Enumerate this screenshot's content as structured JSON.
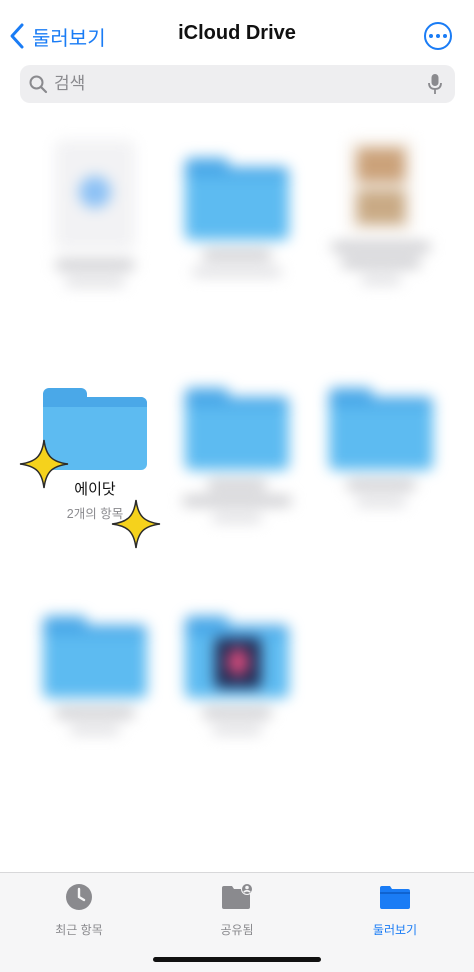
{
  "nav": {
    "back_label": "둘러보기",
    "title": "iCloud Drive",
    "more_icon": "ellipsis-circle-icon"
  },
  "search": {
    "placeholder": "검색",
    "icon": "magnifier-icon",
    "mic_icon": "microphone-icon"
  },
  "items": [
    {
      "kind": "document",
      "name": "",
      "blurred": true
    },
    {
      "kind": "folder",
      "name": "",
      "blurred": true
    },
    {
      "kind": "photo-document",
      "name": "",
      "blurred": true
    },
    {
      "kind": "folder",
      "name": "에이닷",
      "subtitle": "2개의 항목",
      "blurred": false
    },
    {
      "kind": "folder",
      "name": "",
      "blurred": true
    },
    {
      "kind": "folder",
      "name": "",
      "blurred": true
    },
    {
      "kind": "folder",
      "name": "",
      "blurred": true
    },
    {
      "kind": "folder",
      "name": "",
      "blurred": true
    }
  ],
  "tabbar": {
    "tabs": [
      {
        "label": "최근 항목",
        "icon": "clock-icon",
        "active": false
      },
      {
        "label": "공유됨",
        "icon": "shared-folder-icon",
        "active": false
      },
      {
        "label": "둘러보기",
        "icon": "folder-icon",
        "active": true
      }
    ]
  },
  "colors": {
    "accent": "#1a7cf5",
    "folder": "#5dbbf1",
    "sparkle": "#f5d21c"
  }
}
